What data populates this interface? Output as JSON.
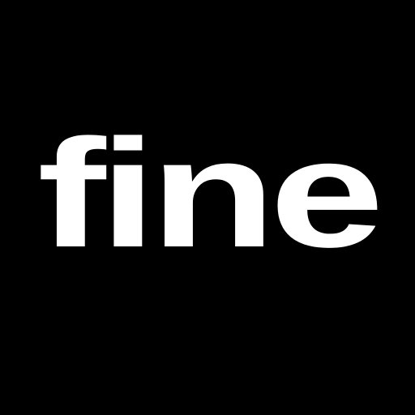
{
  "logo": {
    "wordmark": "fine",
    "text_color": "#FFFFFF",
    "background_color": "#000000"
  }
}
